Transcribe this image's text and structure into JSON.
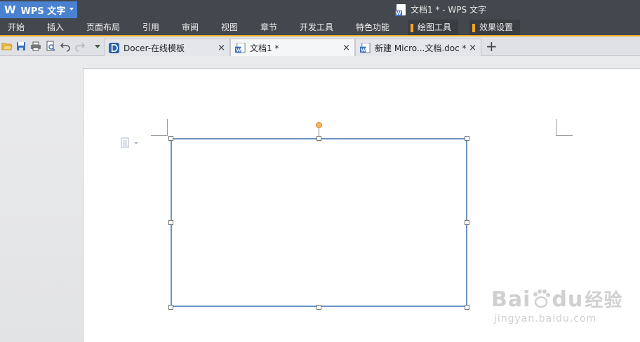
{
  "app": {
    "button_label": "WPS 文字",
    "logo_letter": "W",
    "window_title": "文档1 * - WPS 文字"
  },
  "menu": {
    "items": [
      "开始",
      "插入",
      "页面布局",
      "引用",
      "审阅",
      "视图",
      "章节",
      "开发工具",
      "特色功能"
    ],
    "tool_tabs": [
      "绘图工具",
      "效果设置"
    ]
  },
  "quick_toolbar": {
    "icons": [
      "open-folder-icon",
      "save-icon",
      "print-icon",
      "print-preview-icon",
      "undo-icon",
      "redo-icon",
      "customize-dropdown-icon"
    ]
  },
  "tabs": [
    {
      "label": "Docer-在线模板",
      "close": "×"
    },
    {
      "label": "文档1 *",
      "close": "×"
    },
    {
      "label": "新建 Micro...文档.doc *",
      "close": "×"
    }
  ],
  "new_tab_symbol": "+",
  "watermark": {
    "brand": "Bai",
    "brand2": "du",
    "suffix": "经验",
    "url": "jingyan.baidu.com"
  },
  "colors": {
    "app_button": "#4a82d2",
    "menu_bg": "#44474d",
    "tool_accent": "#f6a623",
    "shape_border": "#6b93c3",
    "rotate_handle": "#f6b26b"
  }
}
